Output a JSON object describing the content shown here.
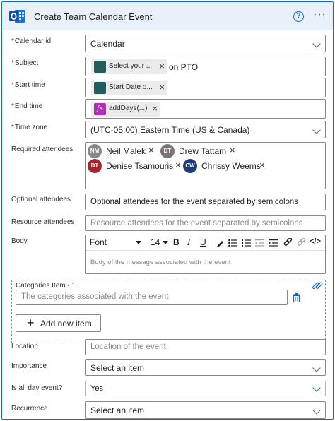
{
  "header": {
    "title": "Create Team Calendar Event",
    "icons": [
      "outlook-calendar-logo",
      "help-icon",
      "more-options-icon"
    ]
  },
  "fields": {
    "calendar_id": {
      "label": "Calendar id",
      "value": "Calendar"
    },
    "subject": {
      "label": "Subject",
      "token": "Select your ...",
      "suffix": "on PTO"
    },
    "start_time": {
      "label": "Start time",
      "token": "Start Date o..."
    },
    "end_time": {
      "label": "End time",
      "token": "addDays(...)",
      "token_icon": "fx"
    },
    "time_zone": {
      "label": "Time zone",
      "value": "(UTC-05:00) Eastern Time (US & Canada)"
    },
    "required_attendees": {
      "label": "Required attendees",
      "people": [
        {
          "initials": "NM",
          "name": "Neil Malek",
          "color": "#8a8886"
        },
        {
          "initials": "DT",
          "name": "Drew Tattam",
          "color": "#7a7574"
        },
        {
          "initials": "DT",
          "name": "Denise Tsamouris",
          "color": "#a4262c"
        },
        {
          "initials": "CW",
          "name": "Chrissy Weems",
          "color": "#1f3b7a"
        }
      ]
    },
    "optional_attendees": {
      "label": "Optional attendees",
      "placeholder": "Optional attendees for the event separated by semicolons"
    },
    "resource_attendees": {
      "label": "Resource attendees",
      "placeholder": "Resource attendees for the event separated by semicolons"
    },
    "body": {
      "label": "Body",
      "font": "Font",
      "size": "14",
      "placeholder": "Body of the message associated with the event"
    },
    "categories": {
      "title": "Categories Item - 1",
      "placeholder": "The categories associated with the event",
      "add_button": "Add new item"
    },
    "location": {
      "label": "Location",
      "placeholder": "Location of the event"
    },
    "importance": {
      "label": "Importance",
      "value": "Select an item"
    },
    "all_day": {
      "label": "Is all day event?",
      "value": "Yes"
    },
    "recurrence": {
      "label": "Recurrence",
      "value": "Select an item"
    }
  },
  "colors": {
    "accent": "#0f6cbd",
    "header_bg": "#eaf0f9",
    "required": "#a4262c",
    "token_icon": "#225c5b",
    "fx_icon": "#b22db3"
  }
}
